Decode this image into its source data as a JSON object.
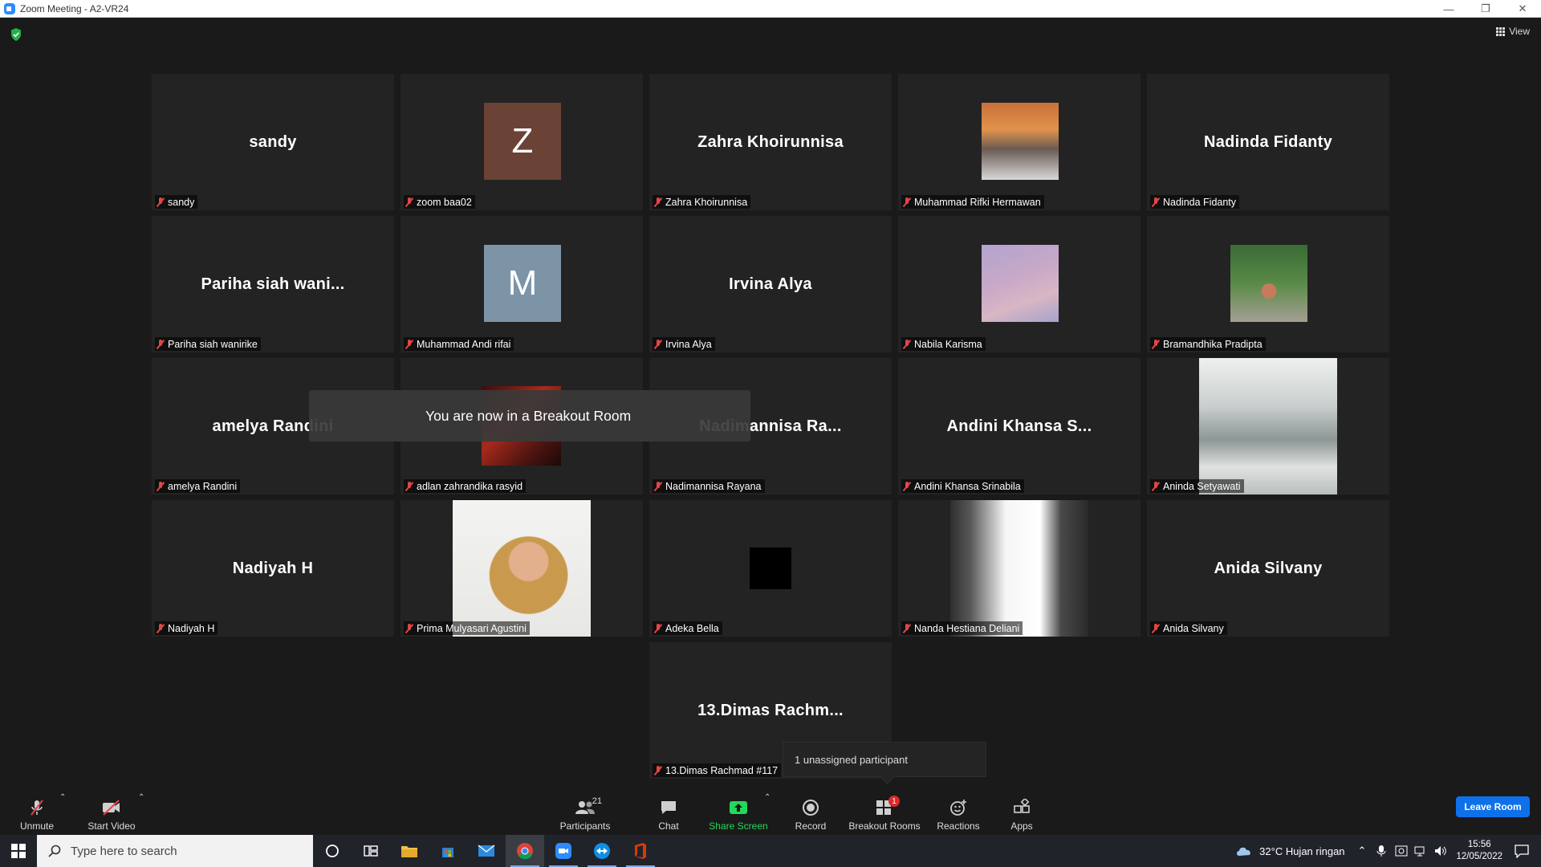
{
  "window": {
    "title": "Zoom Meeting - A2-VR24",
    "view_label": "View"
  },
  "tiles": [
    {
      "display": "sandy",
      "label": "sandy"
    },
    {
      "display": "Z",
      "label": "zoom baa02",
      "avatar_color": "#6b4236"
    },
    {
      "display": "Zahra Khoirunnisa",
      "label": "Zahra Khoirunnisa"
    },
    {
      "display": "",
      "label": "Muhammad Rifki Hermawan"
    },
    {
      "display": "Nadinda Fidanty",
      "label": "Nadinda Fidanty"
    },
    {
      "display": "Pariha siah wani...",
      "label": "Pariha siah wanirike"
    },
    {
      "display": "M",
      "label": "Muhammad Andi rifai",
      "avatar_color": "#7d94a7"
    },
    {
      "display": "Irvina Alya",
      "label": "Irvina Alya"
    },
    {
      "display": "",
      "label": "Nabila Karisma"
    },
    {
      "display": "",
      "label": "Bramandhika Pradipta"
    },
    {
      "display": "amelya Randini",
      "label": "amelya Randini"
    },
    {
      "display": "",
      "label": "adlan zahrandika rasyid"
    },
    {
      "display": "Nadimannisa Ra...",
      "label": "Nadimannisa Rayana"
    },
    {
      "display": "Andini Khansa S...",
      "label": "Andini Khansa Srinabila"
    },
    {
      "display": "",
      "label": "Aninda Setyawati"
    },
    {
      "display": "Nadiyah H",
      "label": "Nadiyah H"
    },
    {
      "display": "",
      "label": "Prima Mulyasari Agustini"
    },
    {
      "display": "",
      "label": "Adeka Bella"
    },
    {
      "display": "",
      "label": "Nanda Hestiana Deliani"
    },
    {
      "display": "Anida Silvany",
      "label": "Anida Silvany"
    },
    {
      "display": "13.Dimas Rachm...",
      "label": "13.Dimas Rachmad #117"
    }
  ],
  "toast": {
    "text": "You are now in a Breakout Room"
  },
  "tooltip": {
    "text": "1 unassigned participant"
  },
  "toolbar": {
    "unmute": "Unmute",
    "start_video": "Start Video",
    "participants": "Participants",
    "participants_count": "21",
    "chat": "Chat",
    "share_screen": "Share Screen",
    "record": "Record",
    "breakout_rooms": "Breakout Rooms",
    "breakout_badge": "1",
    "reactions": "Reactions",
    "apps": "Apps",
    "leave": "Leave Room"
  },
  "taskbar": {
    "search_placeholder": "Type here to search",
    "weather": "32°C  Hujan ringan",
    "time": "15:56",
    "date": "12/05/2022"
  },
  "colors": {
    "share_green": "#23d959",
    "leave_blue": "#0e71eb",
    "muted_red": "#e54545",
    "badge_red": "#e02828"
  }
}
